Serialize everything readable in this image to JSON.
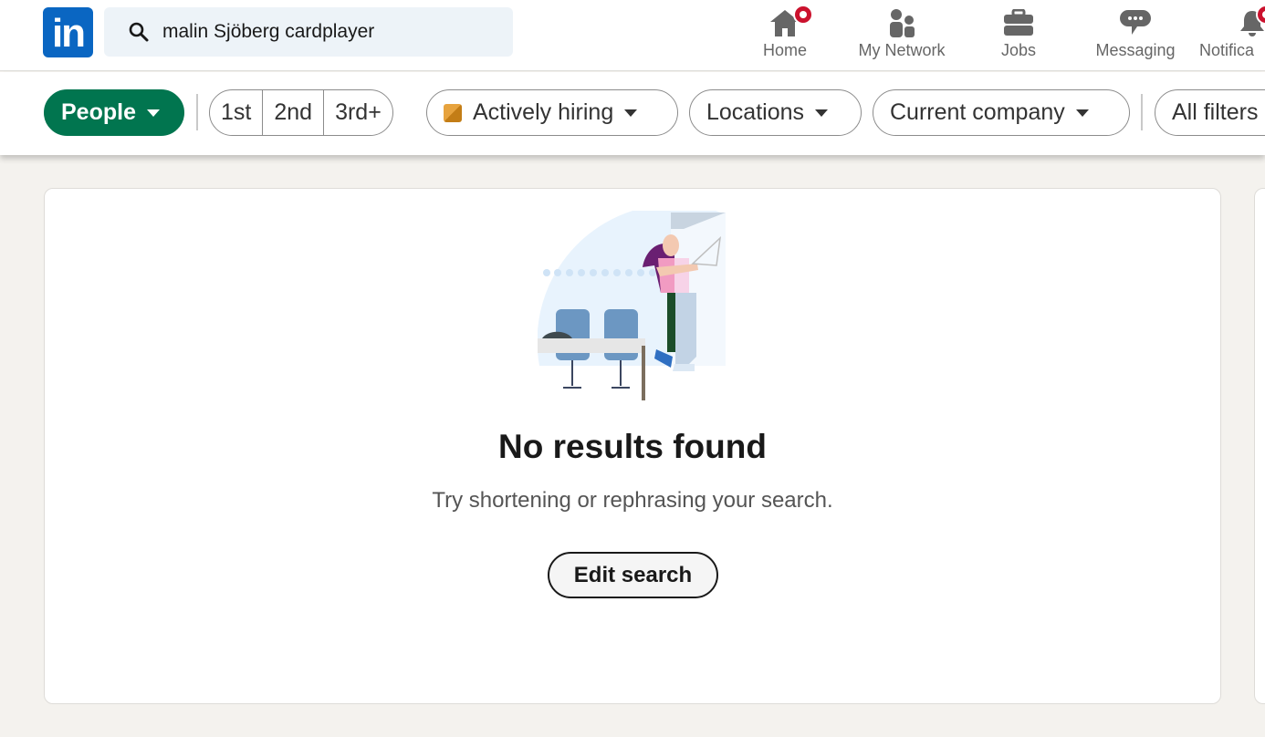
{
  "header": {
    "logo": "in",
    "search_value": "malin Sjöberg cardplayer",
    "nav": [
      {
        "label": "Home",
        "icon": "home-icon",
        "badge": true
      },
      {
        "label": "My Network",
        "icon": "network-icon"
      },
      {
        "label": "Jobs",
        "icon": "briefcase-icon"
      },
      {
        "label": "Messaging",
        "icon": "messaging-icon"
      },
      {
        "label": "Notifica",
        "icon": "bell-icon",
        "badge": true
      }
    ]
  },
  "filters": {
    "people": "People",
    "degrees": [
      "1st",
      "2nd",
      "3rd+"
    ],
    "actively_hiring": "Actively hiring",
    "locations": "Locations",
    "current_company": "Current company",
    "all_filters": "All filters"
  },
  "empty": {
    "title": "No results found",
    "subtitle": "Try shortening or rephrasing your search.",
    "button": "Edit search"
  },
  "colors": {
    "brand": "#0a66c2",
    "people_pill": "#01754f",
    "badge": "#cb112d"
  }
}
